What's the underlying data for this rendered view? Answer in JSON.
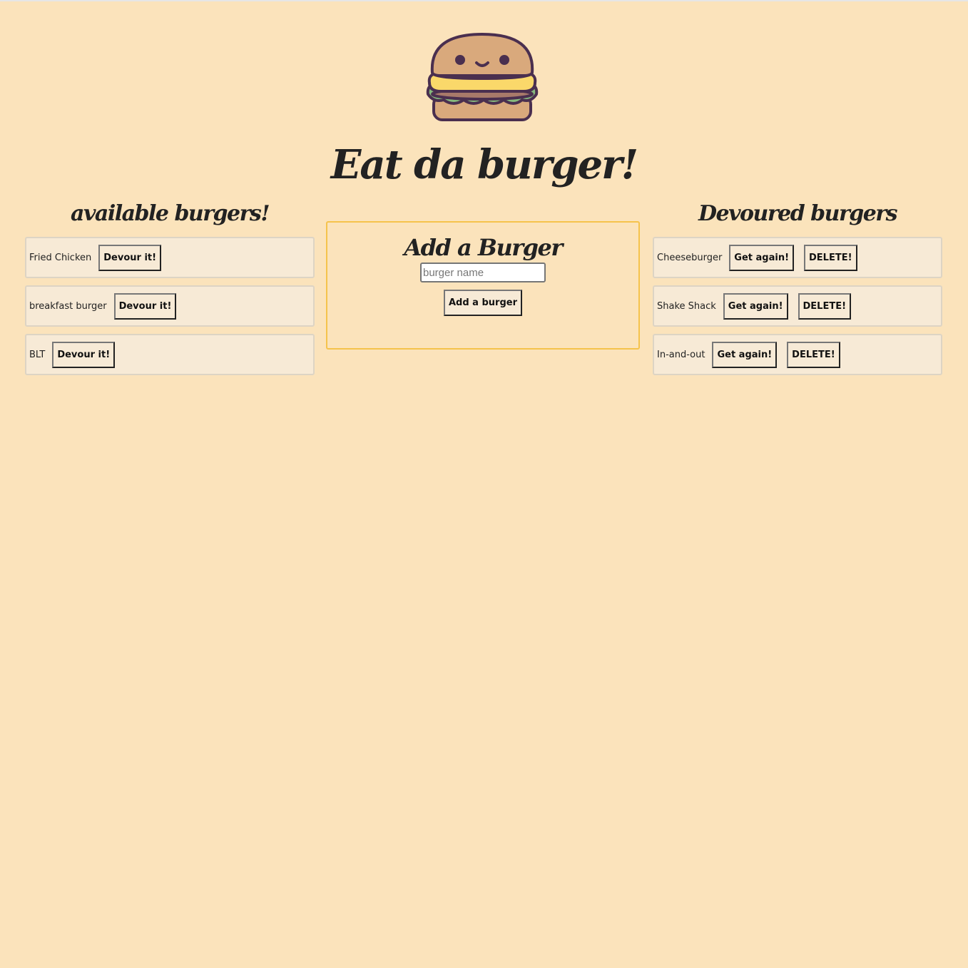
{
  "header": {
    "title": "Eat da burger!"
  },
  "available": {
    "heading": "available burgers!",
    "items": [
      {
        "name": "Fried Chicken",
        "button": "Devour it!"
      },
      {
        "name": "breakfast burger",
        "button": "Devour it!"
      },
      {
        "name": "BLT",
        "button": "Devour it!"
      }
    ]
  },
  "form": {
    "heading": "Add a Burger",
    "placeholder": "burger name",
    "value": "",
    "button": "Add a burger"
  },
  "devoured": {
    "heading": "Devoured burgers",
    "items": [
      {
        "name": "Cheeseburger",
        "again": "Get again!",
        "delete": "DELETE!"
      },
      {
        "name": "Shake Shack",
        "again": "Get again!",
        "delete": "DELETE!"
      },
      {
        "name": "In-and-out",
        "again": "Get again!",
        "delete": "DELETE!"
      }
    ]
  }
}
